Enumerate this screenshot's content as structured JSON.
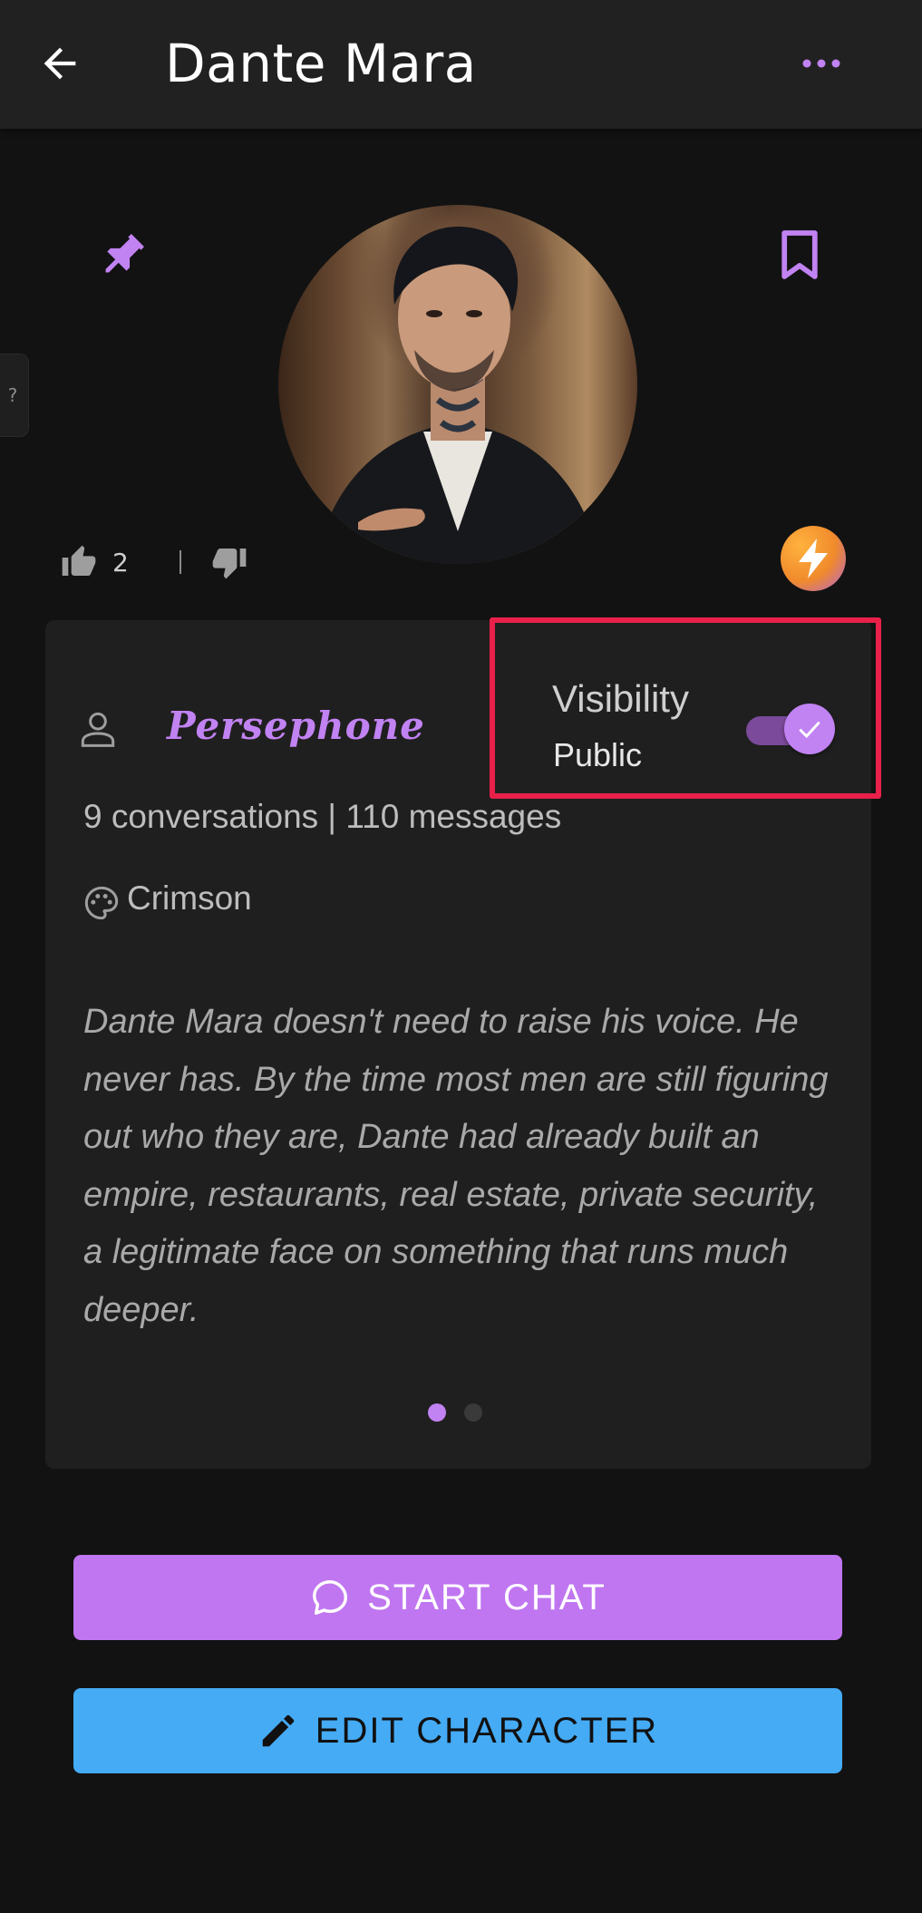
{
  "header": {
    "title": "Dante Mara",
    "back_icon": "arrow-left-icon",
    "more_icon": "more-horizontal-icon"
  },
  "side_help": {
    "label": "?"
  },
  "profile": {
    "pin_icon": "pin-icon",
    "bookmark_icon": "bookmark-icon",
    "avatar_alt": "character-portrait",
    "likes": "2",
    "boost_icon": "lightning-icon"
  },
  "card": {
    "creator_name": "Persephone",
    "visibility_label": "Visibility",
    "visibility_value": "Public",
    "visibility_on": true,
    "stats": "9 conversations | 110 messages",
    "theme": "Crimson",
    "description": "Dante Mara doesn't need to raise his voice. He never has. By the time most men are still figuring out who they are, Dante had already built an empire, restaurants, real estate, private security, a legitimate face on something that runs much deeper.",
    "pager": {
      "count": 2,
      "active": 1
    }
  },
  "actions": {
    "start_chat": "START CHAT",
    "edit_character": "EDIT CHARACTER"
  },
  "colors": {
    "accent": "#c182f2",
    "chat_button": "#c076f0",
    "edit_button": "#45abf5",
    "highlight_box": "#e8204a",
    "background": "#121212",
    "card": "#1f1f1f"
  }
}
